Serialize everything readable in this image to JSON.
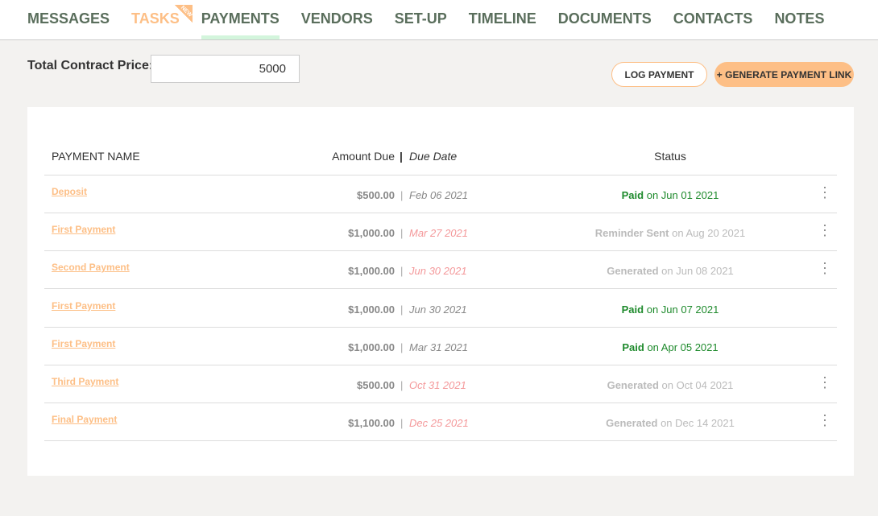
{
  "nav": {
    "tabs": [
      "MESSAGES",
      "TASKS",
      "PAYMENTS",
      "VENDORS",
      "SET-UP",
      "TIMELINE",
      "DOCUMENTS",
      "CONTACTS",
      "NOTES"
    ],
    "new_badge": "NEW",
    "active": "PAYMENTS"
  },
  "contract": {
    "label": "Total Contract Price:",
    "value": "5000"
  },
  "buttons": {
    "log": "LOG PAYMENT",
    "generate": "+ GENERATE PAYMENT LINK"
  },
  "colors": {
    "accent": "#fdbf86",
    "paid": "#1e8a2c",
    "overdue": "#f4989a"
  },
  "table": {
    "headers": {
      "name": "PAYMENT NAME",
      "amount": "Amount Due",
      "sep": "|",
      "due": "Due Date",
      "status": "Status"
    },
    "rows": [
      {
        "name": "Deposit",
        "amount": "$500.00",
        "due": "Feb 06 2021",
        "overdue": false,
        "status": "Paid",
        "status_date": "on Jun 01 2021",
        "paid": true,
        "menu": true
      },
      {
        "name": "First Payment",
        "amount": "$1,000.00",
        "due": "Mar 27 2021",
        "overdue": true,
        "status": "Reminder Sent",
        "status_date": "on Aug 20 2021",
        "paid": false,
        "menu": true
      },
      {
        "name": "Second Payment",
        "amount": "$1,000.00",
        "due": "Jun 30 2021",
        "overdue": true,
        "status": "Generated",
        "status_date": "on Jun 08 2021",
        "paid": false,
        "menu": true
      },
      {
        "name": "First Payment",
        "amount": "$1,000.00",
        "due": "Jun 30 2021",
        "overdue": false,
        "status": "Paid",
        "status_date": "on Jun 07 2021",
        "paid": true,
        "menu": false
      },
      {
        "name": "First Payment",
        "amount": "$1,000.00",
        "due": "Mar 31 2021",
        "overdue": false,
        "status": "Paid",
        "status_date": "on Apr 05 2021",
        "paid": true,
        "menu": false
      },
      {
        "name": "Third Payment",
        "amount": "$500.00",
        "due": "Oct 31 2021",
        "overdue": true,
        "status": "Generated",
        "status_date": "on Oct 04 2021",
        "paid": false,
        "menu": true
      },
      {
        "name": "Final Payment",
        "amount": "$1,100.00",
        "due": "Dec 25 2021",
        "overdue": true,
        "status": "Generated",
        "status_date": "on Dec 14 2021",
        "paid": false,
        "menu": true
      }
    ]
  }
}
